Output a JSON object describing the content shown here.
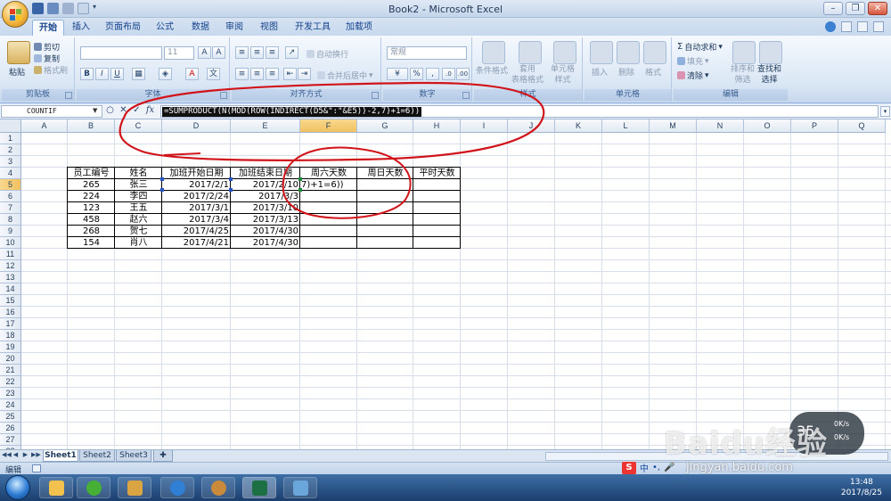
{
  "window": {
    "title": "Book2 - Microsoft Excel"
  },
  "tabs": [
    "开始",
    "插入",
    "页面布局",
    "公式",
    "数据",
    "审阅",
    "视图",
    "开发工具",
    "加载项"
  ],
  "ribbon": {
    "clipboard": {
      "paste": "粘贴",
      "cut": "剪切",
      "copy": "复制",
      "format_painter": "格式刷",
      "label": "剪贴板"
    },
    "font": {
      "size": "11",
      "label": "字体"
    },
    "alignment": {
      "wrap": "自动换行",
      "merge": "合并后居中",
      "label": "对齐方式"
    },
    "number": {
      "format": "常规",
      "percent": "%",
      "label": "数字"
    },
    "styles": {
      "conditional": "条件格式",
      "table": "套用\n表格格式",
      "cell_styles": "单元格\n样式",
      "label": "样式"
    },
    "cells": {
      "insert": "插入",
      "delete": "删除",
      "format": "格式",
      "label": "单元格"
    },
    "editing": {
      "autosum": "自动求和",
      "fill": "填充",
      "clear": "清除",
      "sort": "排序和\n筛选",
      "find": "查找和\n选择",
      "label": "编辑"
    }
  },
  "formula_bar": {
    "name_box": "COUNTIF",
    "fx": "fx",
    "formula": "=SUMPRODUCT(N(MOD(ROW(INDIRECT(D5&\":\"&E5))-2,7)+1=6))"
  },
  "columns": [
    "A",
    "B",
    "C",
    "D",
    "E",
    "F",
    "G",
    "H",
    "I",
    "J",
    "K",
    "L",
    "M",
    "N",
    "O",
    "P",
    "Q"
  ],
  "rows": [
    "1",
    "2",
    "3",
    "4",
    "5",
    "6",
    "7",
    "8",
    "9",
    "10",
    "11",
    "12",
    "13",
    "14",
    "15",
    "16",
    "17",
    "18",
    "19",
    "20",
    "21",
    "22",
    "23",
    "24",
    "25",
    "26",
    "27",
    "28"
  ],
  "table": {
    "headers": [
      "员工编号",
      "姓名",
      "加班开始日期",
      "加班结束日期",
      "周六天数",
      "周日天数",
      "平时天数"
    ],
    "rows": [
      [
        "265",
        "张三",
        "2017/2/1",
        "2017/2/10",
        "7)+1=6))",
        "",
        ""
      ],
      [
        "224",
        "李四",
        "2017/2/24",
        "2017/3/3",
        "",
        "",
        ""
      ],
      [
        "123",
        "王五",
        "2017/3/1",
        "2017/3/10",
        "",
        "",
        ""
      ],
      [
        "458",
        "赵六",
        "2017/3/4",
        "2017/3/13",
        "",
        "",
        ""
      ],
      [
        "268",
        "贺七",
        "2017/4/25",
        "2017/4/30",
        "",
        "",
        ""
      ],
      [
        "154",
        "肖八",
        "2017/4/21",
        "2017/4/30",
        "",
        "",
        ""
      ]
    ]
  },
  "sheets": [
    "Sheet1",
    "Sheet2",
    "Sheet3"
  ],
  "status": {
    "mode": "编辑"
  },
  "overlay": {
    "net_percent": "35",
    "net_up": "0K/s",
    "net_down": "0K/s",
    "watermark": "Baidu经验",
    "watermark_url": "jingyan.baidu.com",
    "ime_text": "中"
  },
  "clock": {
    "time": "13:48",
    "date": "2017/8/25"
  },
  "colors": {
    "annotation": "#d0141a",
    "excel_green": "#1d7044"
  }
}
